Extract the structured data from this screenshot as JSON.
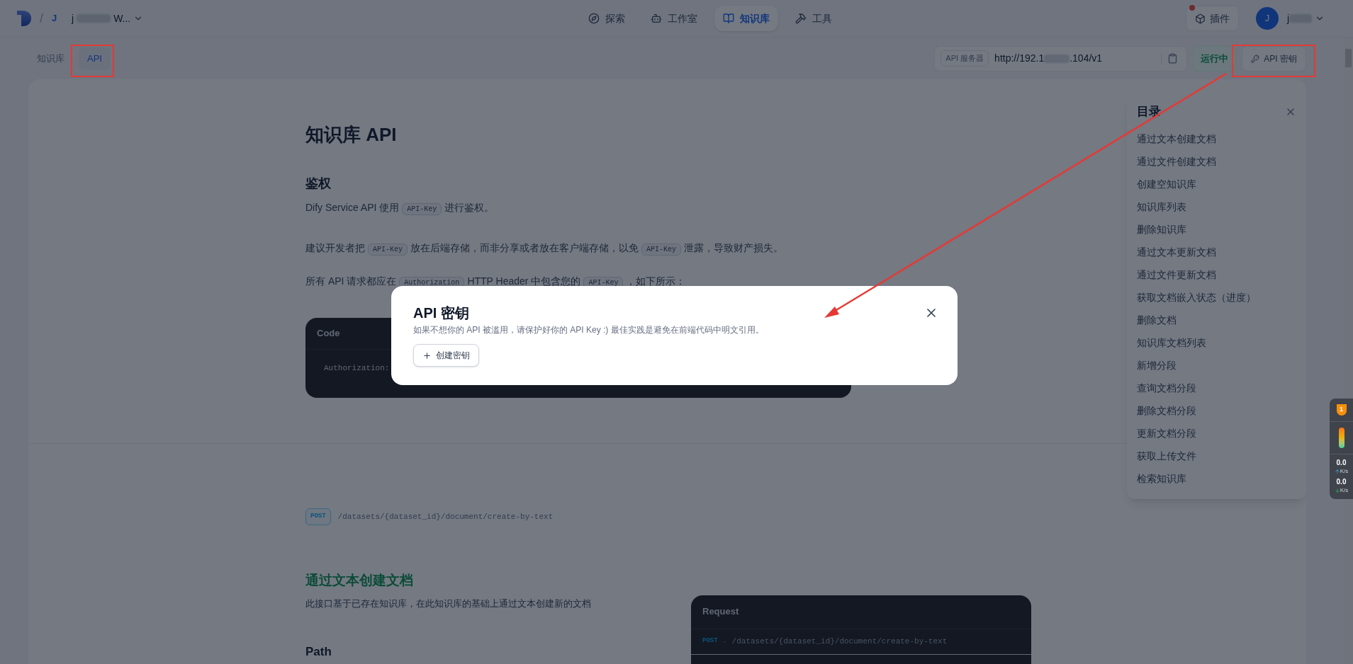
{
  "top_bar": {
    "separator": "/",
    "workspace": {
      "avatar": "J",
      "name_start": "j",
      "name_end": "W..."
    },
    "nav": [
      {
        "kind": "explore",
        "label": "探索",
        "selected": false
      },
      {
        "kind": "studio",
        "label": "工作室",
        "selected": false
      },
      {
        "kind": "knowledge",
        "label": "知识库",
        "selected": true
      },
      {
        "kind": "tools",
        "label": "工具",
        "selected": false
      }
    ],
    "plugins_button": "插件",
    "user": {
      "avatar": "J",
      "name_start": "j"
    }
  },
  "sub_tabs": [
    {
      "label": "知识库",
      "selected": false
    },
    {
      "label": "API",
      "selected": true
    }
  ],
  "api_server": {
    "label": "API 服务器",
    "url_start": "http://192.1",
    "url_end": ".104/v1",
    "status": "运行中",
    "key_button": "API 密钥"
  },
  "doc": {
    "title": "知识库 API",
    "auth_heading": "鉴权",
    "paragraphs": [
      [
        {
          "kind": "text",
          "text": "Dify Service API 使用"
        },
        {
          "kind": "code",
          "text": "API-Key"
        },
        {
          "kind": "text",
          "text": "进行鉴权。"
        }
      ],
      [
        {
          "kind": "text",
          "text": "建议开发者把"
        },
        {
          "kind": "code",
          "text": "API-Key"
        },
        {
          "kind": "text",
          "text": "放在后端存储，而非分享或者放在客户端存储，以免"
        },
        {
          "kind": "code",
          "text": "API-Key"
        },
        {
          "kind": "text",
          "text": "泄露，导致财产损失。"
        }
      ],
      [
        {
          "kind": "text",
          "text": "所有 API 请求都应在"
        },
        {
          "kind": "code",
          "text": "Authorization"
        },
        {
          "kind": "text",
          "text": "HTTP Header 中包含您的"
        },
        {
          "kind": "code",
          "text": "API-Key"
        },
        {
          "kind": "text",
          "text": "，如下所示："
        }
      ]
    ],
    "code_block": {
      "title": "Code",
      "lines": [
        "Authorization:"
      ]
    },
    "endpoint": {
      "method": "POST",
      "path": "/datasets/{dataset_id}/document/create-by-text"
    },
    "section": {
      "title": "通过文本创建文档",
      "description": "此接口基于已存在知识库，在此知识库的基础上通过文本创建新的文档",
      "subheading": "Path"
    },
    "request": {
      "title": "Request",
      "method": "POST",
      "separator": "·",
      "path": "/datasets/{dataset_id}/document/create-by-text"
    }
  },
  "toc": {
    "title": "目录",
    "items": [
      "通过文本创建文档",
      "通过文件创建文档",
      "创建空知识库",
      "知识库列表",
      "删除知识库",
      "通过文本更新文档",
      "通过文件更新文档",
      "获取文档嵌入状态（进度）",
      "删除文档",
      "知识库文档列表",
      "新增分段",
      "查询文档分段",
      "删除文档分段",
      "更新文档分段",
      "获取上传文件",
      "检索知识库"
    ]
  },
  "modal": {
    "title": "API 密钥",
    "description": "如果不想你的 API 被滥用，请保护好你的 API Key :) 最佳实践是避免在前端代码中明文引用。",
    "create_button": "创建密钥"
  },
  "net_meter": {
    "alerts": "1",
    "upload": "0.0",
    "upload_unit": "K/s",
    "download": "0.0",
    "download_unit": "K/s"
  }
}
